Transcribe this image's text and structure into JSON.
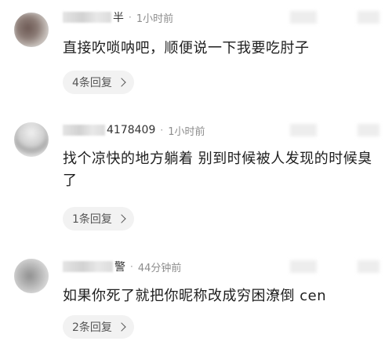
{
  "comments": [
    {
      "name_visible": "半",
      "separator": "·",
      "time": "1小时前",
      "text": "直接吹唢呐吧，顺便说一下我要吃肘子",
      "replies": "4条回复"
    },
    {
      "name_visible": "4178409",
      "separator": "·",
      "time": "1小时前",
      "text": "找个凉快的地方躺着  别到时候被人发现的时候臭了",
      "replies": "1条回复"
    },
    {
      "name_visible": "警",
      "separator": "·",
      "time": "44分钟前",
      "text": "如果你死了就把你昵称改成穷困潦倒 cen",
      "replies": "2条回复"
    }
  ],
  "colors": {
    "text": "#1e1e1e",
    "meta": "#8d8d8d",
    "pill_bg": "#f2f2f2"
  },
  "icons": {
    "reply_chevron": "chevron-right-icon"
  }
}
